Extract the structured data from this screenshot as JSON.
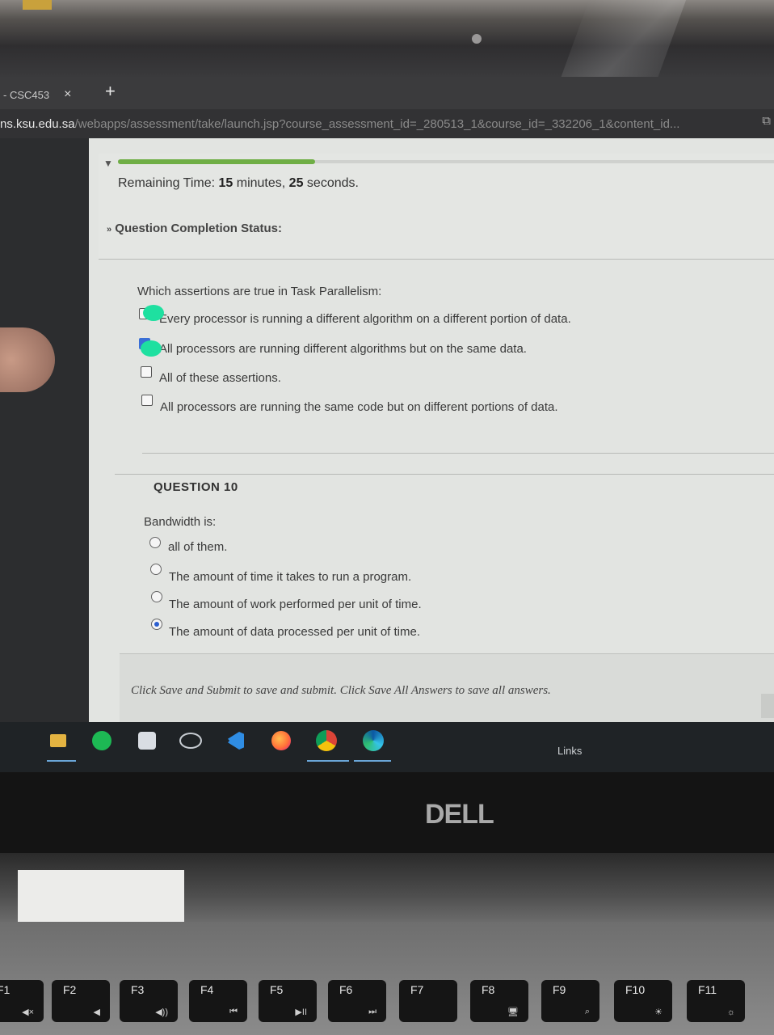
{
  "browser": {
    "tab_title": "- CSC453",
    "tab_close": "×",
    "new_tab": "+",
    "url_host": "ns.ksu.edu.sa",
    "url_path": "/webapps/assessment/take/launch.jsp?course_assessment_id=_280513_1&course_id=_332206_1&content_id..."
  },
  "timer": {
    "label": "Remaining Time:",
    "minutes_value": "15",
    "minutes_unit": "minutes,",
    "seconds_value": "25",
    "seconds_unit": "seconds.",
    "progress_fraction": 0.3
  },
  "completion_status": "Question Completion Status:",
  "question9": {
    "prompt": "Which assertions are true in Task Parallelism:",
    "options": [
      {
        "label": "Every processor is running a different algorithm on a different portion of data.",
        "checked": false
      },
      {
        "label": "All processors are running different algorithms but on the same data.",
        "checked": true
      },
      {
        "label": "All of these assertions.",
        "checked": false
      },
      {
        "label": "All processors are running the same code but on different portions of data.",
        "checked": false
      }
    ]
  },
  "question10": {
    "heading": "QUESTION 10",
    "prompt": "Bandwidth is:",
    "options": [
      {
        "label": "all of them.",
        "selected": false
      },
      {
        "label": "The amount of time it takes to run a program.",
        "selected": false
      },
      {
        "label": "The amount of work performed per unit of time.",
        "selected": false
      },
      {
        "label": "The amount of data processed per unit of time.",
        "selected": true
      }
    ]
  },
  "footer_note": "Click Save and Submit to save and submit. Click Save All Answers to save all answers.",
  "taskbar": {
    "links": "Links",
    "icons": [
      "file-explorer-icon",
      "spotify-icon",
      "app-icon",
      "pen-icon",
      "vscode-icon",
      "firefox-icon",
      "chrome-icon",
      "edge-icon"
    ]
  },
  "laptop": {
    "brand": "DELL",
    "keys": [
      {
        "label": "F1",
        "sub": "◀×"
      },
      {
        "label": "F2",
        "sub": "◀"
      },
      {
        "label": "F3",
        "sub": "◀))"
      },
      {
        "label": "F4",
        "sub": "⏮"
      },
      {
        "label": "F5",
        "sub": "▶II"
      },
      {
        "label": "F6",
        "sub": "⏭"
      },
      {
        "label": "F7",
        "sub": ""
      },
      {
        "label": "F8",
        "sub": "🖥"
      },
      {
        "label": "F9",
        "sub": "⌕"
      },
      {
        "label": "F10",
        "sub": "☀"
      },
      {
        "label": "F11",
        "sub": "☼"
      }
    ]
  },
  "colors": {
    "accent": "#3a6fd6",
    "progress": "#6fae45",
    "highlight_mark": "#1ee0a0"
  }
}
